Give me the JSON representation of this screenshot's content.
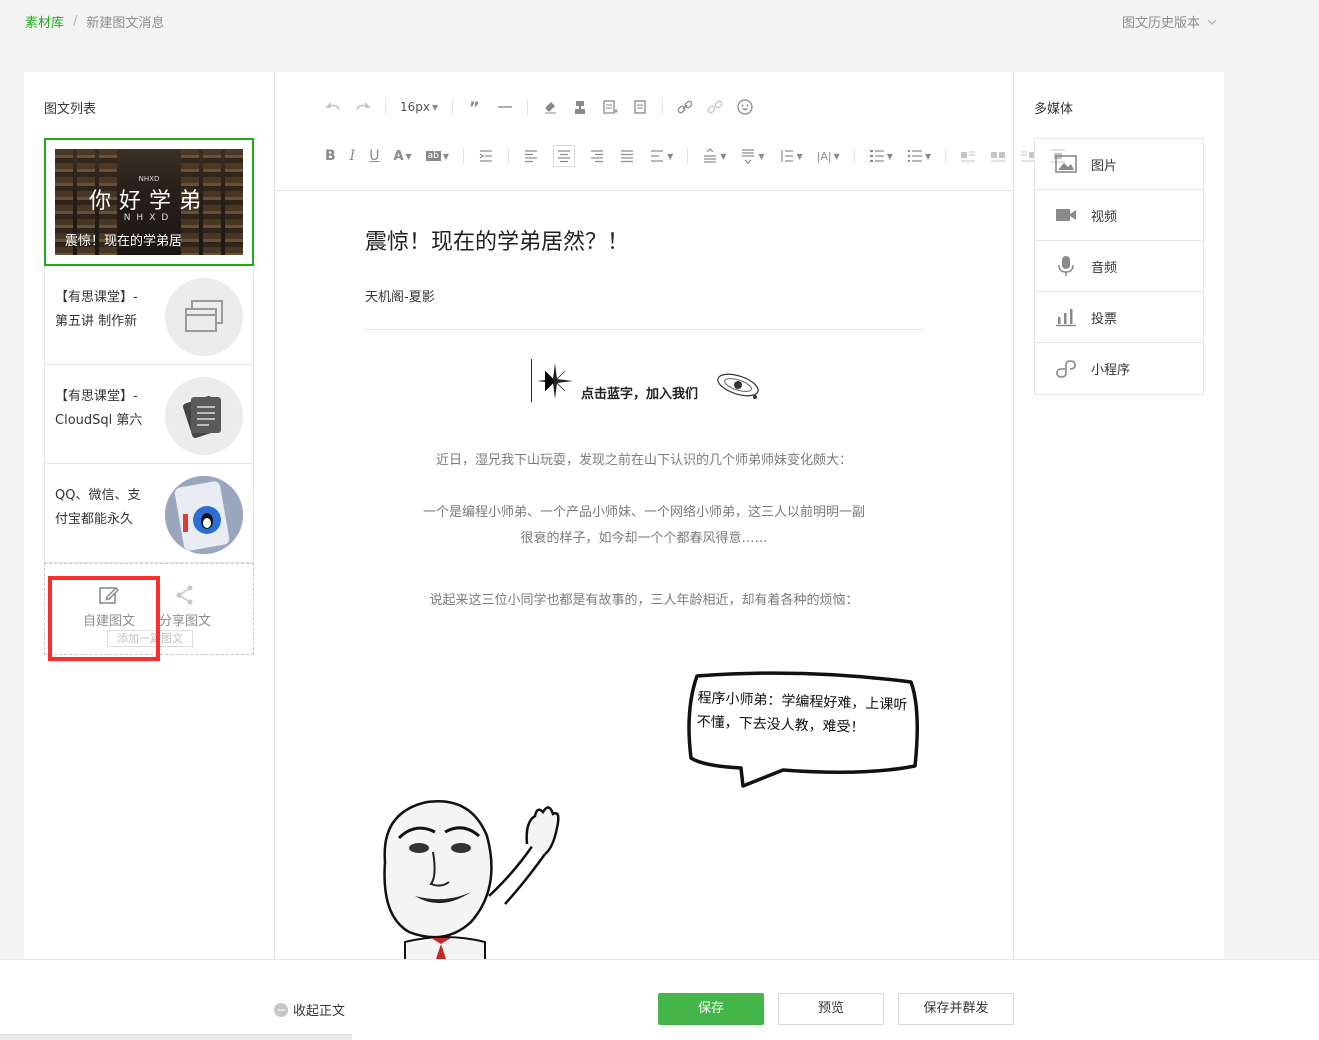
{
  "breadcrumb": {
    "root": "素材库",
    "separator": "/",
    "current": "新建图文消息"
  },
  "history": {
    "label": "图文历史版本"
  },
  "left": {
    "title": "图文列表",
    "cover": {
      "mini": "NHXD",
      "big": "你好学弟",
      "sub": "NHXD",
      "title": "震惊！现在的学弟居"
    },
    "items": [
      {
        "line1": "【有思课堂】-",
        "line2": "第五讲 制作新"
      },
      {
        "line1": "【有思课堂】-",
        "line2": "CloudSql 第六"
      },
      {
        "line1": "QQ、微信、支",
        "line2": "付宝都能永久"
      }
    ],
    "add": {
      "create_label": "自建图文",
      "share_label": "分享图文",
      "tip": "添加一篇图文"
    }
  },
  "toolbar": {
    "font_size": "16px"
  },
  "article": {
    "title": "震惊！现在的学弟居然？！",
    "author": "天机阁-夏影",
    "banner": "点击蓝字，加入我们",
    "p1": "近日，湿兄我下山玩耍，发现之前在山下认识的几个师弟师妹变化颇大：",
    "p2a": "一个是编程小师弟、一个产品小师妹、一个网络小师弟，这三人以前明明一副",
    "p2b": "很衰的样子，如今却一个个都春风得意……",
    "p3": "说起来这三位小同学也都是有故事的，三人年龄相近，却有着各种的烦恼：",
    "bubble": "程序小师弟：学编程好难，上课听不懂，下去没人教，难受！"
  },
  "right": {
    "title": "多媒体",
    "items": [
      {
        "label": "图片",
        "icon": "image-icon"
      },
      {
        "label": "视频",
        "icon": "video-icon"
      },
      {
        "label": "音频",
        "icon": "microphone-icon"
      },
      {
        "label": "投票",
        "icon": "vote-icon"
      },
      {
        "label": "小程序",
        "icon": "mini-program-icon"
      }
    ]
  },
  "bottom": {
    "collapse": "收起正文",
    "save": "保存",
    "preview": "预览",
    "save_send": "保存并群发"
  },
  "colors": {
    "accent": "#1aad19",
    "primary_button": "#44b549",
    "highlight": "#ff2d2d"
  }
}
